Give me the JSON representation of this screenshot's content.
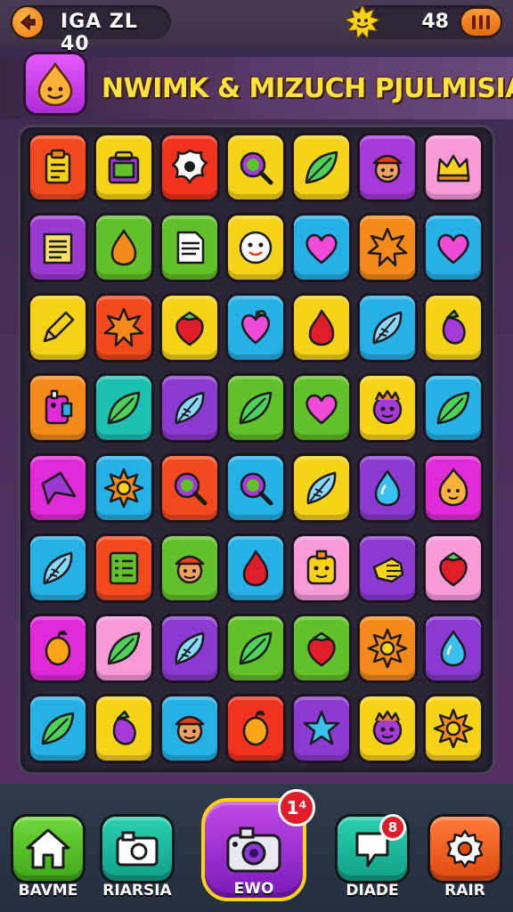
{
  "header": {
    "level_label": "IGA ZL 40",
    "score": "48"
  },
  "banner": {
    "title": "NWIMK & MIZUCH PJULMISIA"
  },
  "board": {
    "rows": [
      [
        {
          "color": "#f24a1e",
          "icon": "clipboard-icon"
        },
        {
          "color": "#f6d318",
          "icon": "bag-icon"
        },
        {
          "color": "#f0321e",
          "icon": "splat-icon"
        },
        {
          "color": "#f6d318",
          "icon": "magnifier-icon"
        },
        {
          "color": "#f6d318",
          "icon": "leaf-icon"
        },
        {
          "color": "#a53ad8",
          "icon": "face-hat-icon"
        },
        {
          "color": "#f89ad8",
          "icon": "crown-icon"
        }
      ],
      [
        {
          "color": "#9b3ad0",
          "icon": "notes-icon"
        },
        {
          "color": "#62c02a",
          "icon": "droplet-icon"
        },
        {
          "color": "#62c02a",
          "icon": "document-icon"
        },
        {
          "color": "#f6d318",
          "icon": "smiley-icon"
        },
        {
          "color": "#26b0e6",
          "icon": "heart-icon"
        },
        {
          "color": "#f58a1c",
          "icon": "star-burst-icon"
        },
        {
          "color": "#26b0e6",
          "icon": "heart-icon"
        }
      ],
      [
        {
          "color": "#f6d318",
          "icon": "pencil-icon"
        },
        {
          "color": "#f24a1e",
          "icon": "star-burst-icon"
        },
        {
          "color": "#f6d318",
          "icon": "strawberry-icon"
        },
        {
          "color": "#26b0e6",
          "icon": "heart-fruit-icon"
        },
        {
          "color": "#f6d318",
          "icon": "flame-icon"
        },
        {
          "color": "#26b0e6",
          "icon": "feather-icon"
        },
        {
          "color": "#f6d318",
          "icon": "eggplant-icon"
        }
      ],
      [
        {
          "color": "#f58a1c",
          "icon": "robot-icon"
        },
        {
          "color": "#1ec0b0",
          "icon": "leaf-icon"
        },
        {
          "color": "#8a3ad0",
          "icon": "feather-icon"
        },
        {
          "color": "#62c02a",
          "icon": "leaf-icon"
        },
        {
          "color": "#62c02a",
          "icon": "heart-icon"
        },
        {
          "color": "#f6d318",
          "icon": "monster-icon"
        },
        {
          "color": "#26b0e6",
          "icon": "leaf-icon"
        }
      ],
      [
        {
          "color": "#e02ad8",
          "icon": "shard-icon"
        },
        {
          "color": "#26b0e6",
          "icon": "sun-icon"
        },
        {
          "color": "#f24a1e",
          "icon": "magnifier-icon"
        },
        {
          "color": "#26b0e6",
          "icon": "magnifier-icon"
        },
        {
          "color": "#f6d318",
          "icon": "feather-icon"
        },
        {
          "color": "#8a3ad0",
          "icon": "water-drop-icon"
        },
        {
          "color": "#e02ad8",
          "icon": "flame-face-icon"
        }
      ],
      [
        {
          "color": "#26b0e6",
          "icon": "feather-icon"
        },
        {
          "color": "#f24a1e",
          "icon": "checklist-icon"
        },
        {
          "color": "#62c02a",
          "icon": "face-hat-icon"
        },
        {
          "color": "#26b0e6",
          "icon": "flame-icon"
        },
        {
          "color": "#f89ad8",
          "icon": "face-block-icon"
        },
        {
          "color": "#8a3ad0",
          "icon": "hand-icon"
        },
        {
          "color": "#f89ad8",
          "icon": "strawberry-icon"
        }
      ],
      [
        {
          "color": "#e02ad8",
          "icon": "lemon-icon"
        },
        {
          "color": "#f89ad8",
          "icon": "leaf-icon"
        },
        {
          "color": "#8a3ad0",
          "icon": "feather-icon"
        },
        {
          "color": "#62c02a",
          "icon": "leaf-icon"
        },
        {
          "color": "#62c02a",
          "icon": "strawberry-icon"
        },
        {
          "color": "#f58a1c",
          "icon": "sun-icon"
        },
        {
          "color": "#8a3ad0",
          "icon": "water-drop-icon"
        }
      ],
      [
        {
          "color": "#26b0e6",
          "icon": "leaf-icon"
        },
        {
          "color": "#f6d318",
          "icon": "eggplant-icon"
        },
        {
          "color": "#26b0e6",
          "icon": "face-hat-icon"
        },
        {
          "color": "#f0321e",
          "icon": "lemon-icon"
        },
        {
          "color": "#8a3ad0",
          "icon": "star-icon"
        },
        {
          "color": "#f6d318",
          "icon": "monster-icon"
        },
        {
          "color": "#f6d318",
          "icon": "sun-icon"
        }
      ]
    ]
  },
  "nav": {
    "home_label": "BAVME",
    "camera_label": "RIARSIA",
    "center_label": "EWO",
    "center_badge": "1⁴",
    "chat_label": "DIADE",
    "chat_badge": "8",
    "settings_label": "RAIR"
  }
}
